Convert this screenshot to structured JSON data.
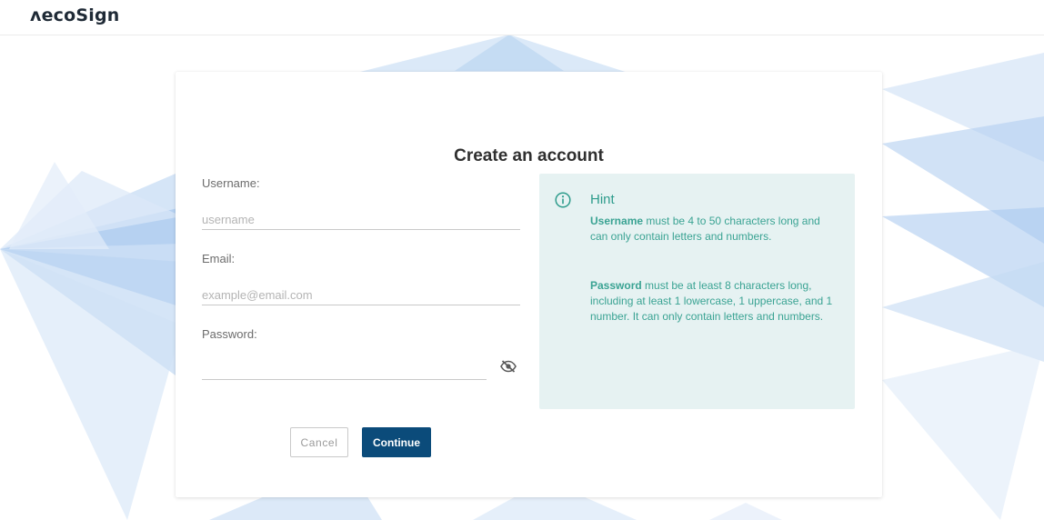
{
  "header": {
    "logo_text": "ʌecoSign"
  },
  "form": {
    "title": "Create an account",
    "username": {
      "label": "Username:",
      "placeholder": "username",
      "value": ""
    },
    "email": {
      "label": "Email:",
      "placeholder": "example@email.com",
      "value": ""
    },
    "password": {
      "label": "Password:",
      "value": ""
    },
    "cancel_label": "Cancel",
    "continue_label": "Continue"
  },
  "hint": {
    "title": "Hint",
    "username_term": "Username",
    "username_text": " must be 4 to 50 characters long and can only contain letters and numbers.",
    "password_term": "Password",
    "password_text": " must be at least 8 characters long, including at least 1 lowercase, 1 uppercase, and 1 number. It can only contain letters and numbers."
  },
  "colors": {
    "primary": "#0b4b7a",
    "hint_bg": "#e6f2f2",
    "hint_text": "#3aa393",
    "background_accent": "#a9c8ee"
  },
  "icons": {
    "hint": "info-circle-icon",
    "password_toggle": "eye-off-icon"
  }
}
